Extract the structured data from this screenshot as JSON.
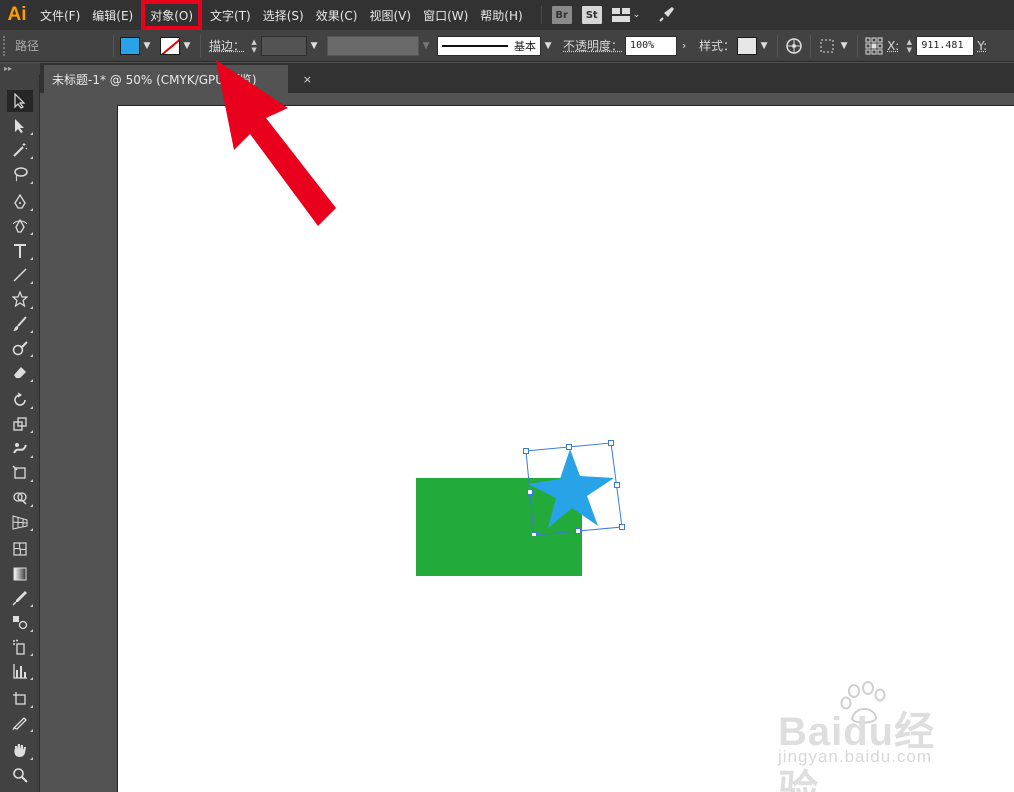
{
  "app": {
    "logo": "Ai"
  },
  "menu": [
    {
      "label": "文件(F)",
      "highlight": false
    },
    {
      "label": "编辑(E)",
      "highlight": false
    },
    {
      "label": "对象(O)",
      "highlight": true
    },
    {
      "label": "文字(T)",
      "highlight": false
    },
    {
      "label": "选择(S)",
      "highlight": false
    },
    {
      "label": "效果(C)",
      "highlight": false
    },
    {
      "label": "视图(V)",
      "highlight": false
    },
    {
      "label": "窗口(W)",
      "highlight": false
    },
    {
      "label": "帮助(H)",
      "highlight": false
    }
  ],
  "menubar_icons": {
    "bridge": "Br",
    "stock": "St"
  },
  "controlbar": {
    "selection_type": "路径",
    "stroke_label": "描边：",
    "stroke_profile": "基本",
    "opacity_label": "不透明度：",
    "opacity_value": "100%",
    "style_label": "样式：",
    "x_label": "X:",
    "x_value": "911.481",
    "y_label": "Y:"
  },
  "colors": {
    "fill": "#29a3e8",
    "star": "#29a3e8",
    "rect": "#22ab3b",
    "annotation": "#e8001c",
    "logo": "#ff9a00"
  },
  "document_tab": {
    "title": "未标题-1* @ 50% (CMYK/GPU 预览)",
    "close": "×"
  },
  "tools": [
    "selection-tool-icon",
    "direct-selection-tool-icon",
    "magic-wand-tool-icon",
    "lasso-tool-icon",
    "pen-tool-icon",
    "curvature-tool-icon",
    "type-tool-icon",
    "line-segment-tool-icon",
    "star-tool-icon",
    "paintbrush-tool-icon",
    "shaper-tool-icon",
    "eraser-tool-icon",
    "rotate-tool-icon",
    "scale-tool-icon",
    "warp-tool-icon",
    "free-transform-tool-icon",
    "shape-builder-tool-icon",
    "perspective-grid-tool-icon",
    "mesh-tool-icon",
    "gradient-tool-icon",
    "eyedropper-tool-icon",
    "blend-tool-icon",
    "symbol-sprayer-tool-icon",
    "column-graph-tool-icon",
    "artboard-tool-icon",
    "slice-tool-icon",
    "hand-tool-icon",
    "zoom-tool-icon"
  ],
  "watermark": {
    "main": "Baidu经验",
    "sub": "jingyan.baidu.com"
  }
}
